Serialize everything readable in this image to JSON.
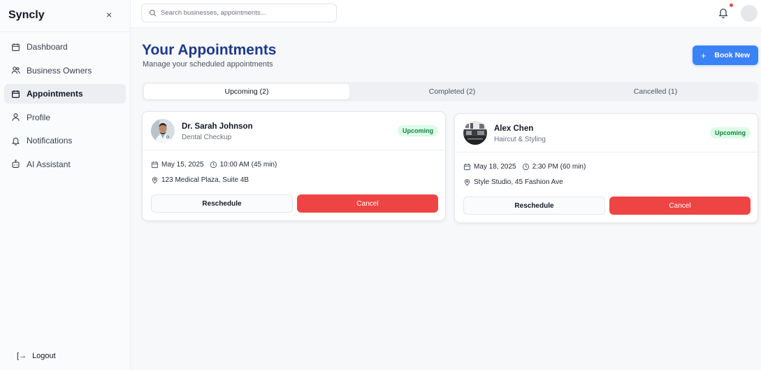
{
  "app": {
    "name": "Syncly"
  },
  "sidebar": {
    "items": [
      {
        "label": "Dashboard",
        "icon": "calendar-icon"
      },
      {
        "label": "Business Owners",
        "icon": "users-icon"
      },
      {
        "label": "Appointments",
        "icon": "calendar-icon",
        "active": true
      },
      {
        "label": "Profile",
        "icon": "user-icon"
      },
      {
        "label": "Notifications",
        "icon": "bell-icon"
      },
      {
        "label": "AI Assistant",
        "icon": "bot-icon"
      }
    ],
    "logout_label": "Logout",
    "close_glyph": "×",
    "logout_glyph": "[→"
  },
  "topbar": {
    "search_placeholder": "Search businesses, appointments..."
  },
  "page": {
    "title": "Your Appointments",
    "subtitle": "Manage your scheduled appointments",
    "book_label": "Book New",
    "book_glyph": "+"
  },
  "tabs": [
    {
      "label": "Upcoming (2)",
      "active": true
    },
    {
      "label": "Completed (2)"
    },
    {
      "label": "Cancelled (1)"
    }
  ],
  "appointments": [
    {
      "name": "Dr. Sarah Johnson",
      "service": "Dental Checkup",
      "status": "Upcoming",
      "date": "May 15, 2025",
      "time": "10:00 AM (45 min)",
      "location": "123 Medical Plaza, Suite 4B",
      "reschedule_label": "Reschedule",
      "cancel_label": "Cancel"
    },
    {
      "name": "Alex Chen",
      "service": "Haircut & Styling",
      "status": "Upcoming",
      "date": "May 18, 2025",
      "time": "2:30 PM (60 min)",
      "location": "Style Studio, 45 Fashion Ave",
      "reschedule_label": "Reschedule",
      "cancel_label": "Cancel"
    }
  ],
  "colors": {
    "accent": "#3b82f6",
    "title": "#1e3a8a",
    "cancel": "#ef4444",
    "badge_bg": "#dcfce7",
    "badge_text": "#15803d",
    "notification_dot": "#ef4444"
  }
}
